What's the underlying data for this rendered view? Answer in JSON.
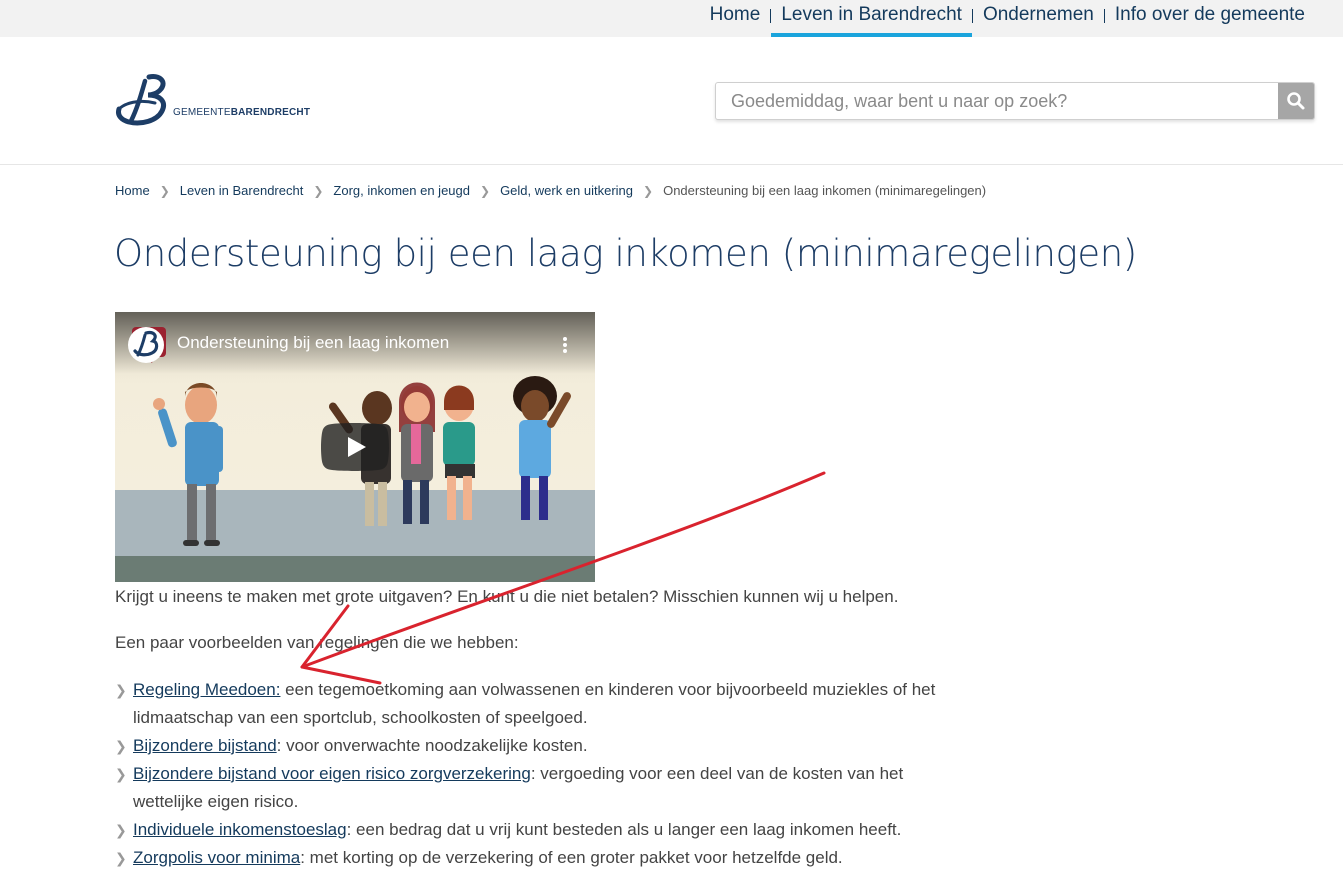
{
  "topnav": {
    "items": [
      {
        "label": "Home"
      },
      {
        "label": "Leven in Barendrecht"
      },
      {
        "label": "Ondernemen"
      },
      {
        "label": "Info over de gemeente"
      }
    ],
    "active_index": 1
  },
  "logo": {
    "text_light": "GEMEENTE",
    "text_bold": "BARENDRECHT"
  },
  "search": {
    "placeholder": "Goedemiddag, waar bent u naar op zoek?",
    "button_icon": "search-icon"
  },
  "breadcrumb": [
    "Home",
    "Leven in Barendrecht",
    "Zorg, inkomen en jeugd",
    "Geld, werk en uitkering",
    "Ondersteuning bij een laag inkomen (minimaregelingen)"
  ],
  "page": {
    "title": "Ondersteuning bij een laag inkomen (minimaregelingen)",
    "video_title": "Ondersteuning bij een laag inkomen",
    "intro": "Krijgt u ineens te maken met grote uitgaven? En kunt u die niet betalen? Misschien kunnen wij u helpen.",
    "examples_intro": "Een paar voorbeelden van regelingen die we hebben:"
  },
  "regelingen": [
    {
      "link": "Regeling Meedoen:",
      "text": " een tegemoetkoming aan volwassenen en kinderen voor bijvoorbeeld muziekles of het",
      "text2": "lidmaatschap van een sportclub, schoolkosten of speelgoed."
    },
    {
      "link": "Bijzondere bijstand",
      "text": ": voor onverwachte noodzakelijke kosten.",
      "text2": ""
    },
    {
      "link": "Bijzondere bijstand voor eigen risico zorgverzekering",
      "text": ": vergoeding voor een deel van de kosten van het",
      "text2": "wettelijke eigen risico."
    },
    {
      "link": "Individuele inkomenstoeslag",
      "text": ": een bedrag dat u vrij kunt besteden als u langer een laag inkomen heeft.",
      "text2": ""
    },
    {
      "link": "Zorgpolis voor minima",
      "text": ": met korting op de verzekering of een groter pakket voor hetzelfde geld.",
      "text2": ""
    }
  ],
  "colors": {
    "brand": "#143a5c",
    "accent": "#1aa4dc",
    "annotation": "#d9232e"
  }
}
